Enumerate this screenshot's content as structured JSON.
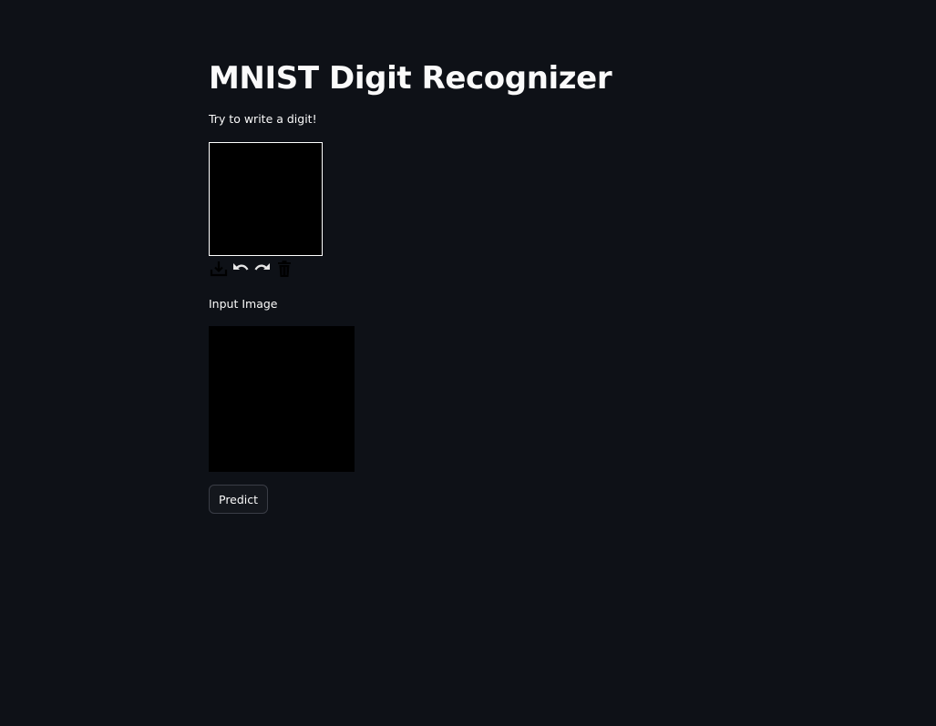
{
  "page": {
    "title": "MNIST Digit Recognizer",
    "subtitle": "Try to write a digit!"
  },
  "canvas": {
    "background": "#000000",
    "border_color": "#ffffff"
  },
  "toolbar": {
    "icons": [
      "download-icon",
      "undo-icon",
      "redo-icon",
      "trash-icon"
    ],
    "download_color": "#000000",
    "undo_color": "#e6e6e6",
    "redo_color": "#e6e6e6",
    "trash_color": "#000000"
  },
  "input_image": {
    "label": "Input Image"
  },
  "actions": {
    "predict_label": "Predict"
  },
  "colors": {
    "background": "#0e1117",
    "text": "#fafafa",
    "button_border": "#3a3d46"
  }
}
